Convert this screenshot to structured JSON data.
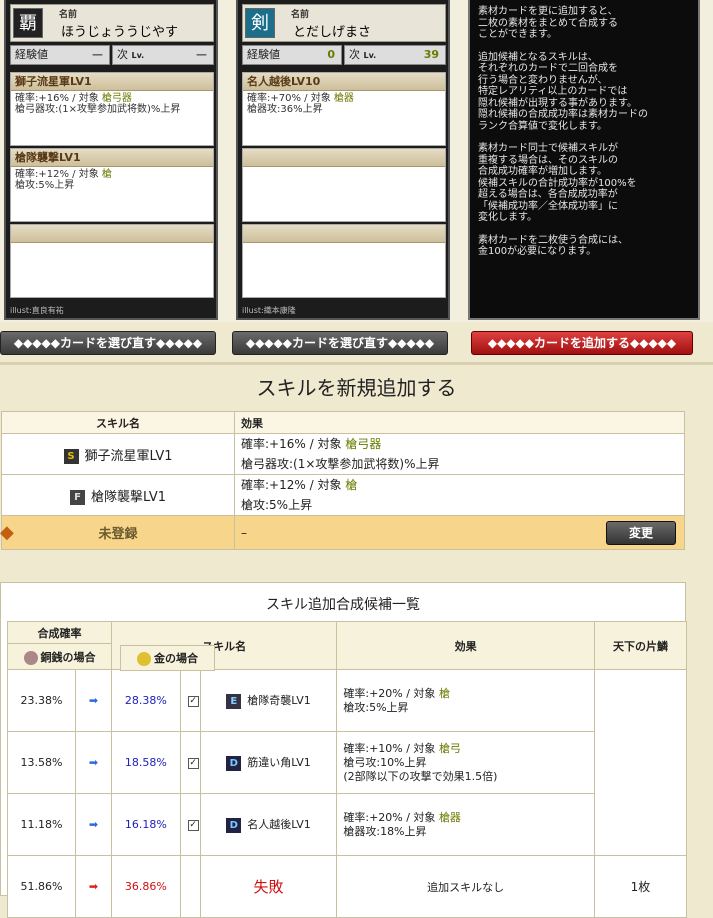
{
  "card1": {
    "name_label": "名前",
    "name": "ほうじょううじやす",
    "icon": "覇",
    "exp_label": "経験値",
    "exp_value": "—",
    "next_label": "次",
    "lv_label": "Lv.",
    "next_value": "—",
    "skills": [
      {
        "title": "獅子流星軍LV1",
        "line1": "確率:+16% / 対象 ",
        "target": "槍弓器",
        "line2": "槍弓器攻:(1×攻撃参加武将数)%上昇"
      },
      {
        "title": "槍隊襲撃LV1",
        "line1": "確率:+12% / 対象 ",
        "target": "槍",
        "line2": "槍攻:5%上昇"
      },
      {
        "title": "",
        "line1": "",
        "target": "",
        "line2": ""
      }
    ],
    "illust": "illust:直良有祐"
  },
  "card2": {
    "name_label": "名前",
    "name": "とだしげまさ",
    "icon": "剣",
    "exp_label": "経験値",
    "exp_value": "0",
    "next_label": "次",
    "lv_label": "Lv.",
    "next_value": "39",
    "skills": [
      {
        "title": "名人越後LV10",
        "line1": "確率:+70% / 対象 ",
        "target": "槍器",
        "line2": "槍器攻:36%上昇"
      },
      {
        "title": "",
        "line1": "",
        "target": "",
        "line2": ""
      },
      {
        "title": "",
        "line1": "",
        "target": "",
        "line2": ""
      }
    ],
    "illust": "illust:織本康隆"
  },
  "help": [
    "素材カードを更に追加すると、\n二枚の素材をまとめて合成する\nことができます。",
    "追加候補となるスキルは、\nそれぞれのカードで二回合成を\n行う場合と変わりませんが、\n特定レアリティ以上のカードでは\n隠れ候補が出現する事があります。\n隠れ候補の合成成功率は素材カードの\nランク合算値で変化します。",
    "素材カード同士で候補スキルが\n重複する場合は、そのスキルの\n合成成功確率が増加します。\n候補スキルの合計成功率が100%を\n超える場合は、各合成成功率が\n「候補成功率／全体成功率」に\n変化します。",
    "素材カードを二枚使う合成には、\n金100が必要になります。"
  ],
  "buttons": {
    "reselect1": "◆◆◆◆◆カードを選び直す◆◆◆◆◆",
    "reselect2": "◆◆◆◆◆カードを選び直す◆◆◆◆◆",
    "add_card": "◆◆◆◆◆カードを追加する◆◆◆◆◆"
  },
  "section_title": "スキルを新規追加する",
  "skill_table": {
    "col_name": "スキル名",
    "col_effect": "効果",
    "rows": [
      {
        "badge": "S",
        "name": "獅子流星軍LV1",
        "line1": "確率:+16% / 対象 ",
        "target": "槍弓器",
        "line2": "槍弓器攻:(1×攻撃参加武将数)%上昇"
      },
      {
        "badge": "F",
        "name": "槍隊襲撃LV1",
        "line1": "確率:+12% / 対象 ",
        "target": "槍",
        "line2": "槍攻:5%上昇"
      }
    ],
    "unregistered": "未登録",
    "unreg_effect": "–",
    "change_btn": "変更"
  },
  "cand_title": "スキル追加合成候補一覧",
  "cand_table": {
    "h_rate": "合成確率",
    "h_copper": "銅銭の場合",
    "h_gold": "金の場合",
    "h_skill": "スキル名",
    "h_effect": "効果",
    "h_piece": "天下の片鱗",
    "rows": [
      {
        "copper": "23.38%",
        "gold": "28.38%",
        "badge": "E",
        "skill": "槍隊奇襲LV1",
        "l1": "確率:+20% / 対象 ",
        "tg": "槍",
        "l2": "槍攻:5%上昇",
        "l3": ""
      },
      {
        "copper": "13.58%",
        "gold": "18.58%",
        "badge": "D",
        "skill": "筋違い角LV1",
        "l1": "確率:+10% / 対象 ",
        "tg": "槍弓",
        "l2": "槍弓攻:10%上昇",
        "l3": "(2部隊以下の攻撃で効果1.5倍)"
      },
      {
        "copper": "11.18%",
        "gold": "16.18%",
        "badge": "D",
        "skill": "名人越後LV1",
        "l1": "確率:+20% / 対象 ",
        "tg": "槍器",
        "l2": "槍器攻:18%上昇",
        "l3": ""
      }
    ],
    "fail": {
      "copper": "51.86%",
      "gold": "36.86%",
      "skill": "失敗",
      "effect": "追加スキルなし",
      "piece": "1枚"
    }
  }
}
